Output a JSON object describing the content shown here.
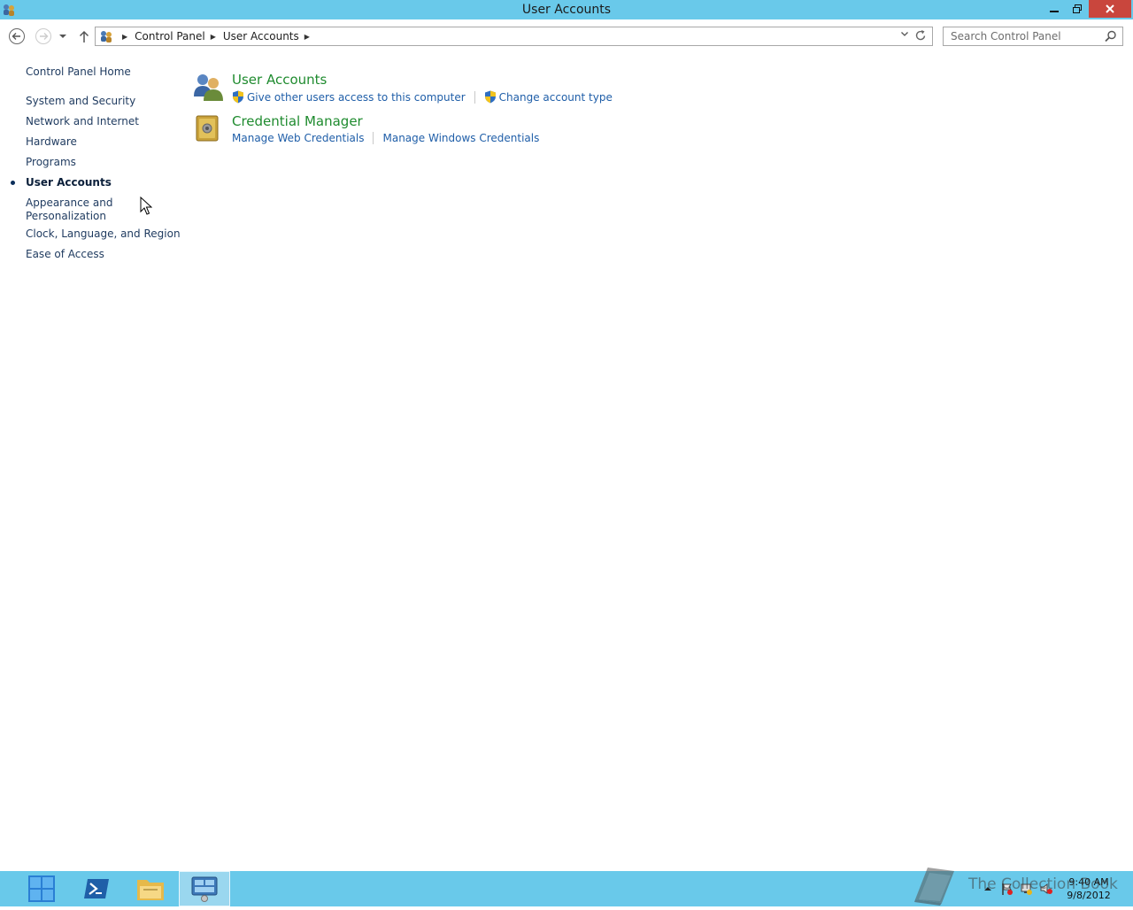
{
  "window": {
    "title": "User Accounts",
    "buttons": {
      "minimize": "minimize",
      "maximize": "restore",
      "close": "close"
    }
  },
  "address": {
    "crumbs": [
      "Control Panel",
      "User Accounts"
    ]
  },
  "search": {
    "placeholder": "Search Control Panel"
  },
  "sidebar": {
    "home": "Control Panel Home",
    "items": [
      {
        "label": "System and Security"
      },
      {
        "label": "Network and Internet"
      },
      {
        "label": "Hardware"
      },
      {
        "label": "Programs"
      },
      {
        "label": "User Accounts",
        "current": true
      },
      {
        "label": "Appearance and Personalization"
      },
      {
        "label": "Clock, Language, and Region"
      },
      {
        "label": "Ease of Access"
      }
    ]
  },
  "categories": [
    {
      "title": "User Accounts",
      "icon": "user-accounts-icon",
      "links": [
        {
          "label": "Give other users access to this computer",
          "shield": true
        },
        {
          "label": "Change account type",
          "shield": true
        }
      ]
    },
    {
      "title": "Credential Manager",
      "icon": "credential-vault-icon",
      "links": [
        {
          "label": "Manage Web Credentials",
          "shield": false
        },
        {
          "label": "Manage Windows Credentials",
          "shield": false
        }
      ]
    }
  ],
  "taskbar": {
    "clock": {
      "time": "9:40 AM",
      "date": "9/8/2012"
    }
  },
  "watermark": "The Collection Book",
  "colors": {
    "titlebar": "#69c9ea",
    "category_title": "#1f8b2f",
    "link": "#1f5ea8",
    "close": "#c9463d"
  }
}
